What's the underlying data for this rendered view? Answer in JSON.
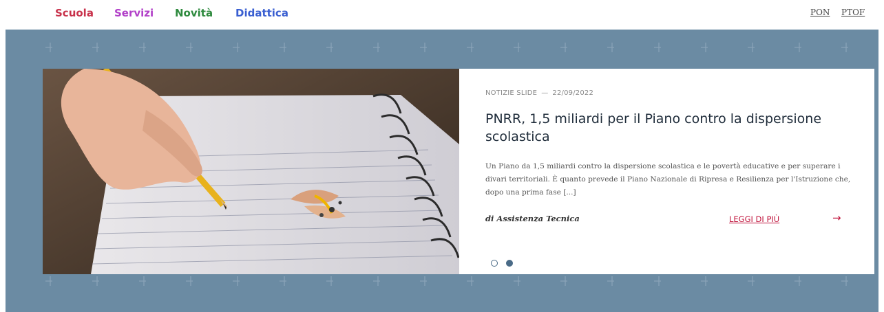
{
  "nav": {
    "items": [
      {
        "label": "Scuola",
        "color": "#c8324b"
      },
      {
        "label": "Servizi",
        "color": "#b13fc8"
      },
      {
        "label": "Novità",
        "color": "#2e8a3e"
      },
      {
        "label": "Didattica",
        "color": "#3a5fd1"
      }
    ],
    "right_links": [
      "PON",
      "PTOF"
    ]
  },
  "slide": {
    "category": "NOTIZIE SLIDE",
    "separator": "—",
    "date": "22/09/2022",
    "title": "PNRR, 1,5 miliardi per il Piano contro la dispersione scolastica",
    "excerpt": "Un Piano da 1,5 miliardi contro la dispersione scolastica e le povertà educative e per superare i divari territoriali. È quanto prevede il Piano Nazionale di Ripresa e Resilienza per l'Istruzione che, dopo una prima fase [...]",
    "author": "di Assistenza Tecnica",
    "read_more": "LEGGI DI PIÙ",
    "arrow_icon": "→",
    "image_icon": "pencil-notebook-photo"
  },
  "carousel": {
    "slide_count": 2,
    "active_index": 1
  },
  "colors": {
    "band": "#6b8ba3",
    "accent": "#c0143c"
  }
}
